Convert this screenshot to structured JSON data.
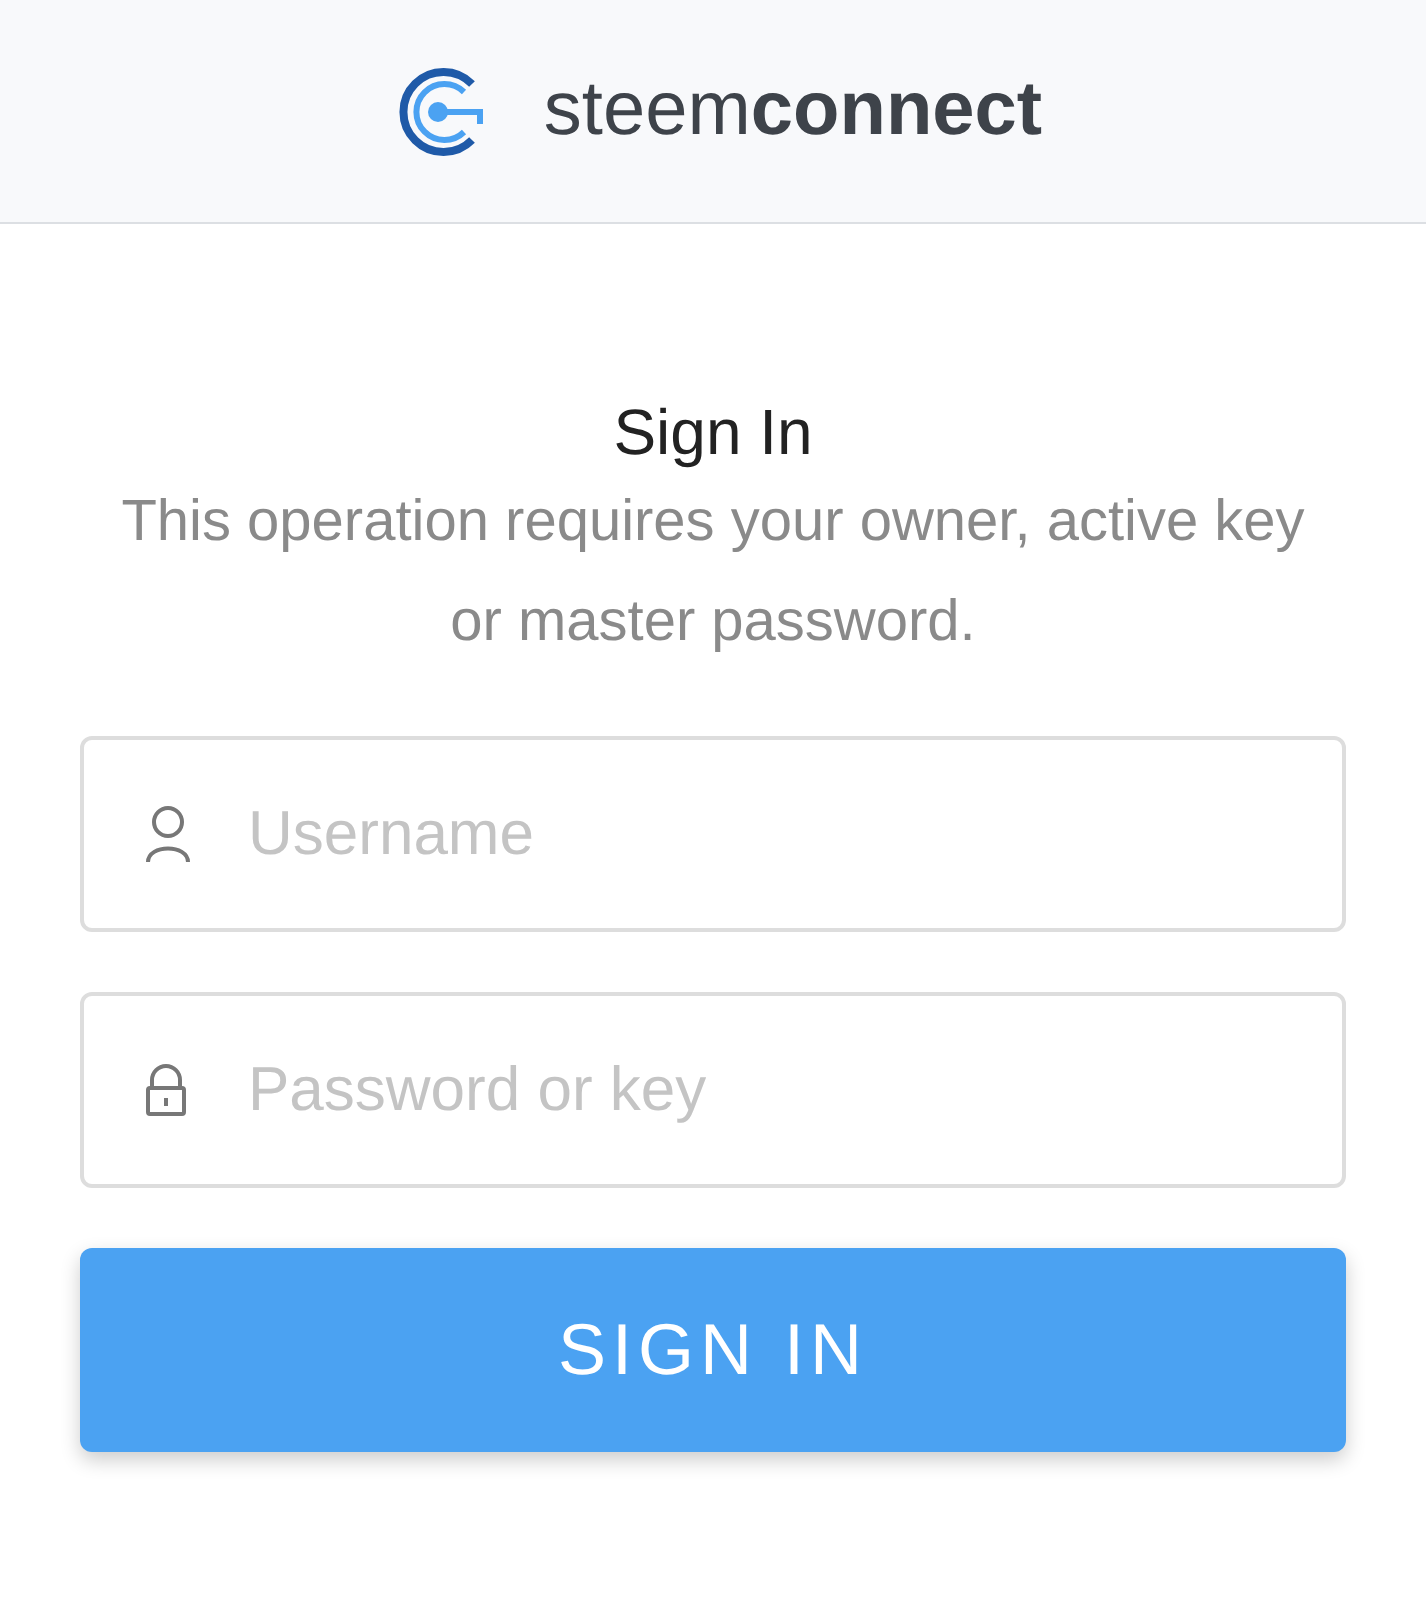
{
  "header": {
    "logo_text": "steem**connect**"
  },
  "title": "Sign In",
  "description": "This operation requires your owner, active key or master password.",
  "fields": [
    {
      "kind": "user",
      "placeholder": "Username"
    },
    {
      "kind": "lock",
      "placeholder": "Password or key"
    }
  ],
  "submit": "SIGN IN"
}
